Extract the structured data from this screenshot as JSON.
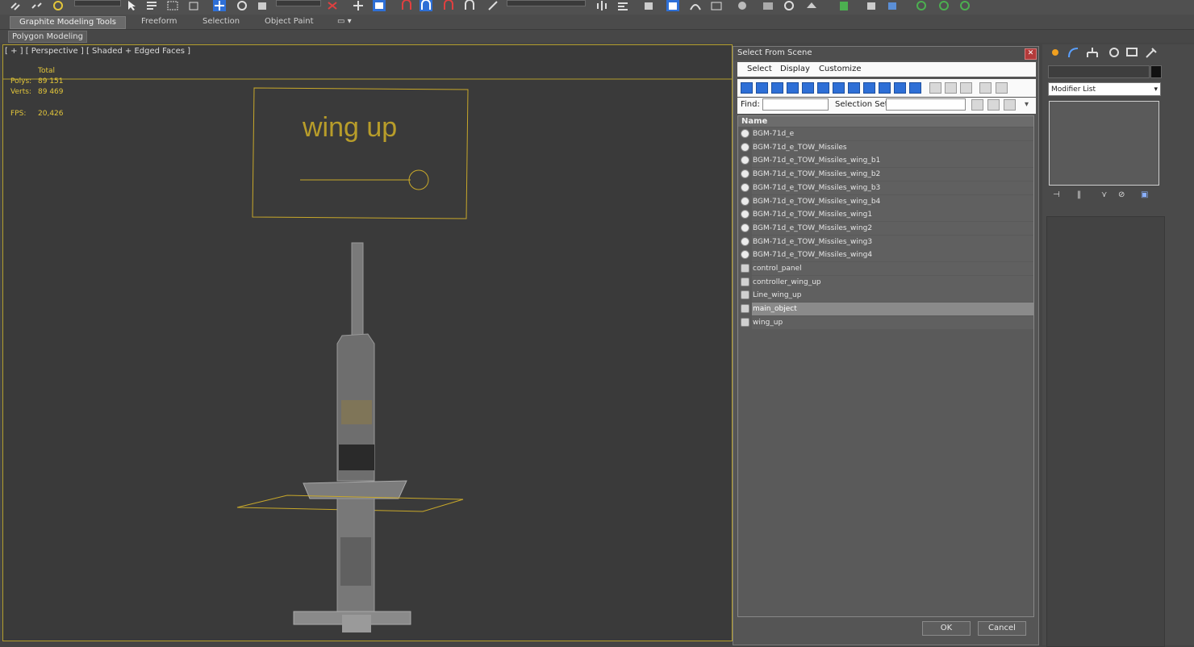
{
  "ribbon": {
    "tabs": [
      "Graphite Modeling Tools",
      "Freeform",
      "Selection",
      "Object Paint"
    ],
    "subtab": "Polygon Modeling"
  },
  "viewport": {
    "label": "[ + ] [ Perspective ] [ Shaded + Edged Faces ]",
    "stats": {
      "header": "Total",
      "polys_label": "Polys:",
      "polys_value": "89 151",
      "verts_label": "Verts:",
      "verts_value": "89 469",
      "fps_label": "FPS:",
      "fps_value": "20,426"
    },
    "panel_text": "wing up"
  },
  "dialog": {
    "title": "Select From Scene",
    "menu": [
      "Select",
      "Display",
      "Customize"
    ],
    "find_label": "Find:",
    "selection_set_label": "Selection Set:",
    "column_header": "Name",
    "items": [
      {
        "name": "BGM-71d_e",
        "icon": "geometry-icon"
      },
      {
        "name": "BGM-71d_e_TOW_Missiles",
        "icon": "geometry-icon"
      },
      {
        "name": "BGM-71d_e_TOW_Missiles_wing_b1",
        "icon": "geometry-icon"
      },
      {
        "name": "BGM-71d_e_TOW_Missiles_wing_b2",
        "icon": "geometry-icon"
      },
      {
        "name": "BGM-71d_e_TOW_Missiles_wing_b3",
        "icon": "geometry-icon"
      },
      {
        "name": "BGM-71d_e_TOW_Missiles_wing_b4",
        "icon": "geometry-icon"
      },
      {
        "name": "BGM-71d_e_TOW_Missiles_wing1",
        "icon": "geometry-icon"
      },
      {
        "name": "BGM-71d_e_TOW_Missiles_wing2",
        "icon": "geometry-icon"
      },
      {
        "name": "BGM-71d_e_TOW_Missiles_wing3",
        "icon": "geometry-icon"
      },
      {
        "name": "BGM-71d_e_TOW_Missiles_wing4",
        "icon": "geometry-icon"
      },
      {
        "name": "control_panel",
        "icon": "shape-icon"
      },
      {
        "name": "controller_wing_up",
        "icon": "shape-icon"
      },
      {
        "name": "Line_wing_up",
        "icon": "shape-icon"
      },
      {
        "name": "main_object",
        "icon": "shape-icon",
        "selected": true
      },
      {
        "name": "wing_up",
        "icon": "shape-icon"
      }
    ],
    "ok_label": "OK",
    "cancel_label": "Cancel"
  },
  "command_panel": {
    "modifier_list": "Modifier List"
  },
  "colors": {
    "accent_yellow": "#e3c63a",
    "viewport_bg": "#3a3a3a",
    "toolbar_blue": "#2e6fd6"
  }
}
